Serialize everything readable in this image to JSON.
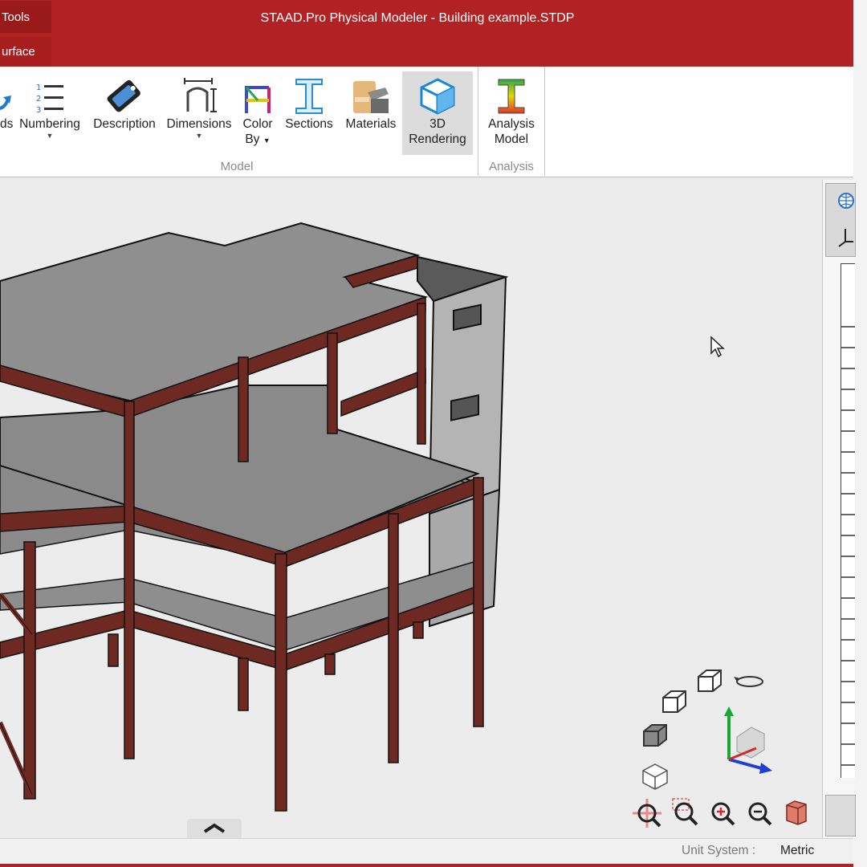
{
  "window": {
    "title": "STAAD.Pro Physical Modeler - Building example.STDP",
    "context_tabs": [
      "Tools",
      "urface"
    ]
  },
  "ribbon": {
    "model_group": {
      "label": "Model",
      "buttons": [
        {
          "label": "ds",
          "icon": "rotate-arrow-icon"
        },
        {
          "label": "Numbering",
          "icon": "numbering-list-icon",
          "has_dropdown": true
        },
        {
          "label": "Description",
          "icon": "tag-icon"
        },
        {
          "label": "Dimensions",
          "icon": "dimension-frame-icon",
          "has_dropdown": true
        },
        {
          "label": "Color",
          "label2": "By",
          "icon": "color-frame-icon",
          "has_dropdown": true
        },
        {
          "label": "Sections",
          "icon": "i-beam-section-icon"
        },
        {
          "label": "Materials",
          "icon": "materials-icon"
        },
        {
          "label": "3D",
          "label2": "Rendering",
          "icon": "cube-3d-icon",
          "active": true
        }
      ]
    },
    "analysis_group": {
      "label": "Analysis",
      "buttons": [
        {
          "label": "Analysis",
          "label2": "Model",
          "icon": "analysis-beam-icon"
        }
      ]
    }
  },
  "status": {
    "unit_system_label": "Unit System :",
    "unit_system_value": "Metric"
  },
  "colors": {
    "title_bar": "#b02223",
    "steel_beam": "#6e2a22",
    "slab": "#8e8e8e",
    "wall": "#b4b4b4",
    "active_button": "#dcdcdc"
  }
}
